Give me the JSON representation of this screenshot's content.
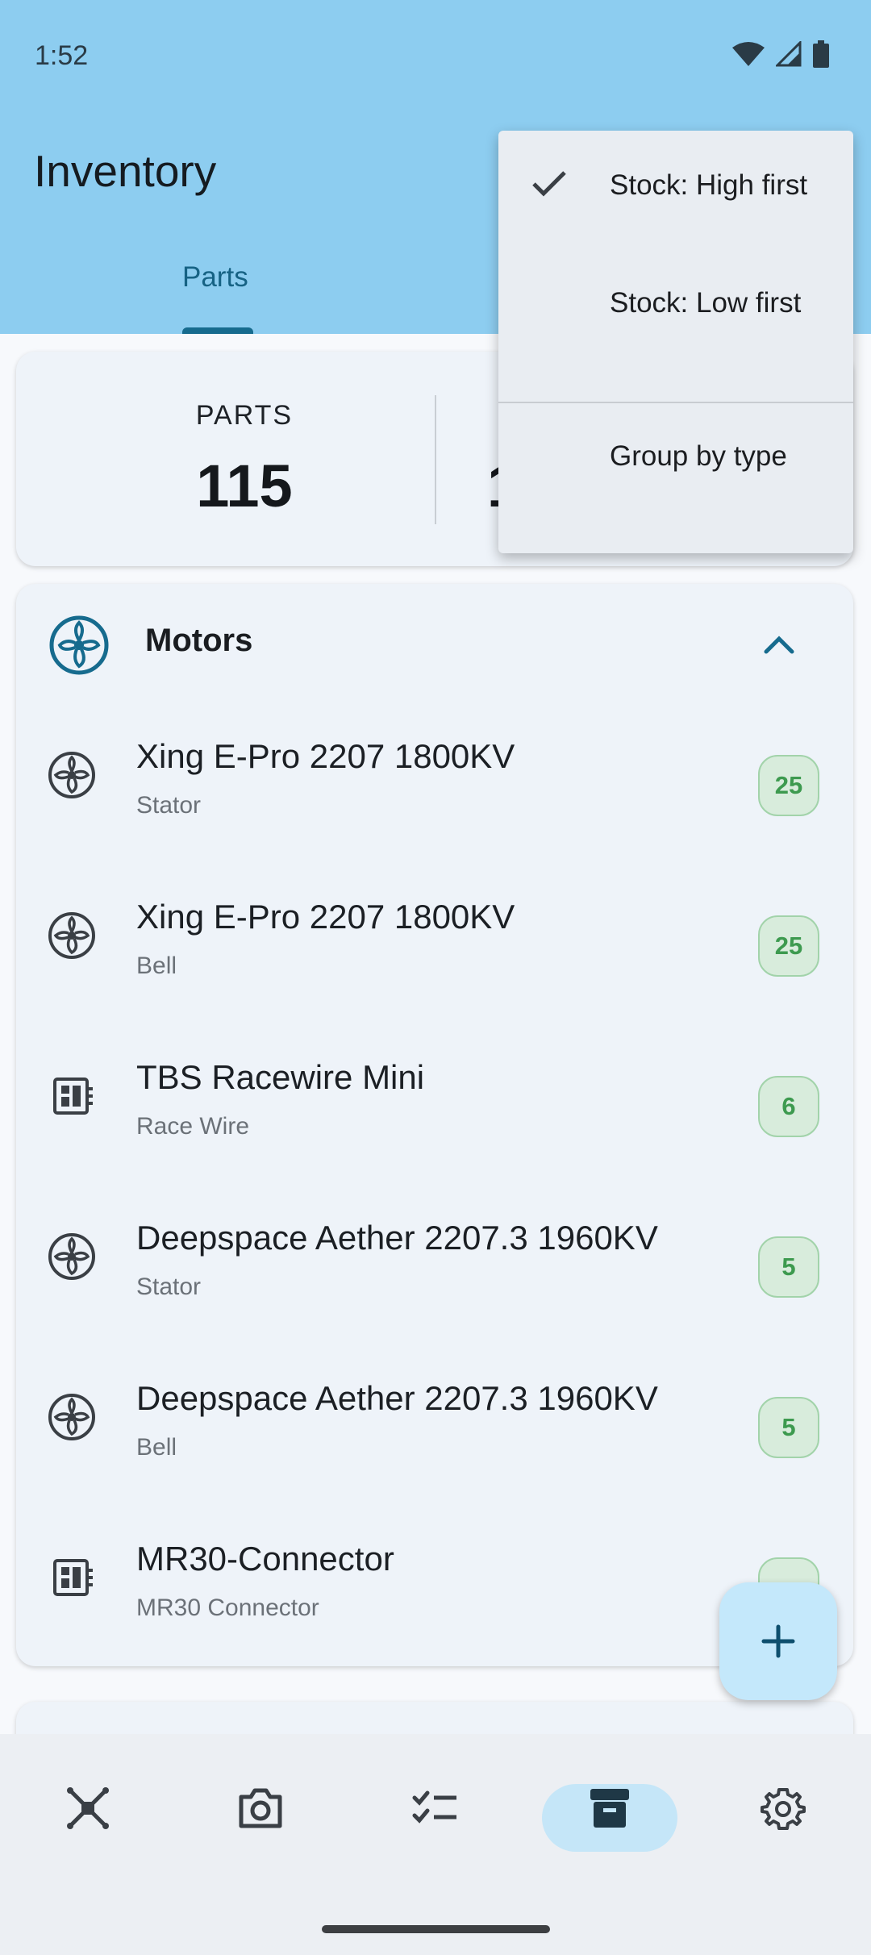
{
  "status_bar": {
    "time": "1:52"
  },
  "app_bar": {
    "title": "Inventory"
  },
  "tabs": [
    {
      "label": "Parts",
      "selected": true
    }
  ],
  "stats": {
    "parts_label": "PARTS",
    "parts_value": "115",
    "second_value_partial": "1"
  },
  "group": {
    "title": "Motors",
    "expanded": true
  },
  "items": [
    {
      "name": "Xing E-Pro 2207 1800KV",
      "type": "Stator",
      "qty": "25"
    },
    {
      "name": "Xing E-Pro 2207 1800KV",
      "type": "Bell",
      "qty": "25"
    },
    {
      "name": "TBS Racewire Mini",
      "type": "Race Wire",
      "qty": "6"
    },
    {
      "name": "Deepspace Aether 2207.3 1960KV",
      "type": "Stator",
      "qty": "5"
    },
    {
      "name": "Deepspace Aether 2207.3 1960KV",
      "type": "Bell",
      "qty": "5"
    },
    {
      "name": "MR30-Connector",
      "type": "MR30 Connector",
      "qty": ""
    }
  ],
  "item_icons": [
    "motor-icon",
    "motor-icon",
    "board-icon",
    "motor-icon",
    "motor-icon",
    "board-icon"
  ],
  "sort_menu": {
    "options": [
      {
        "label": "Stock: High first",
        "checked": true
      },
      {
        "label": "Stock: Low first",
        "checked": false
      },
      {
        "label": "Group by type",
        "checked": false
      }
    ]
  },
  "bottom_nav": {
    "items": [
      "drone-icon",
      "camera-icon",
      "checklist-icon",
      "inventory-icon",
      "settings-icon"
    ],
    "active_index": 3
  },
  "colors": {
    "header": "#8dcdf0",
    "accent": "#166b8e",
    "badge_green": "#3d9a4f",
    "fab": "#c4e8fb"
  }
}
